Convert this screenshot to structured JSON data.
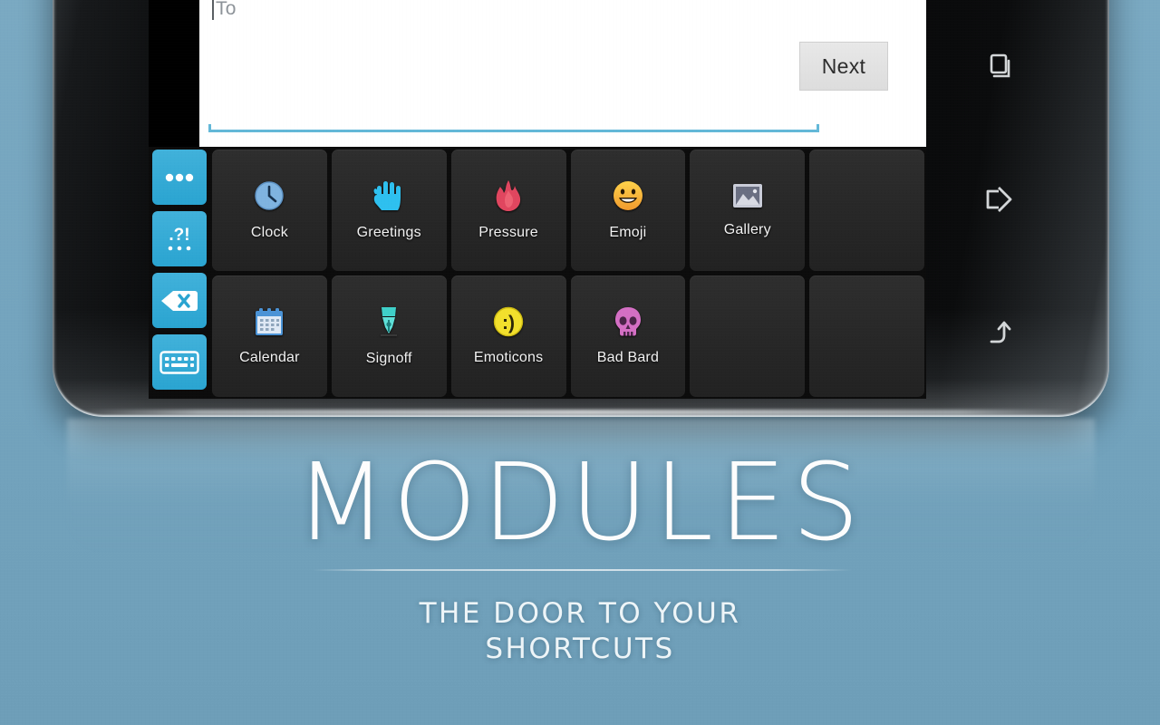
{
  "theme": {
    "background_color": "#72a3bd",
    "accent_blue": "#2aa4d1",
    "tile_color": "#2a2a2a",
    "underline_color": "#63b8d8"
  },
  "compose": {
    "to_placeholder": "To",
    "next_label": "Next"
  },
  "keyboard": {
    "sidebar_keys": [
      {
        "name": "more-options-key",
        "icon": "three-dots-icon"
      },
      {
        "name": "punctuation-key",
        "icon": "punctuation-icon"
      },
      {
        "name": "backspace-key",
        "icon": "backspace-icon"
      },
      {
        "name": "hide-keyboard-key",
        "icon": "keyboard-icon"
      }
    ],
    "modules": [
      {
        "label": "Clock",
        "icon": "clock-icon",
        "empty": false
      },
      {
        "label": "Greetings",
        "icon": "hand-icon",
        "empty": false
      },
      {
        "label": "Pressure",
        "icon": "flame-icon",
        "empty": false
      },
      {
        "label": "Emoji",
        "icon": "smiley-icon",
        "empty": false
      },
      {
        "label": "Gallery",
        "icon": "picture-icon",
        "empty": false
      },
      {
        "label": "",
        "icon": "",
        "empty": true
      },
      {
        "label": "Calendar",
        "icon": "calendar-icon",
        "empty": false
      },
      {
        "label": "Signoff",
        "icon": "pen-nib-icon",
        "empty": false
      },
      {
        "label": "Emoticons",
        "icon": "emoticon-icon",
        "empty": false
      },
      {
        "label": "Bad Bard",
        "icon": "skull-icon",
        "empty": false
      },
      {
        "label": "",
        "icon": "",
        "empty": true
      },
      {
        "label": "",
        "icon": "",
        "empty": true
      }
    ]
  },
  "navbar": {
    "recents_label": "Recent apps",
    "home_label": "Home",
    "back_label": "Back"
  },
  "marketing": {
    "title": "MODULES",
    "subtitle_line1": "THE DOOR TO YOUR",
    "subtitle_line2": "SHORTCUTS"
  }
}
